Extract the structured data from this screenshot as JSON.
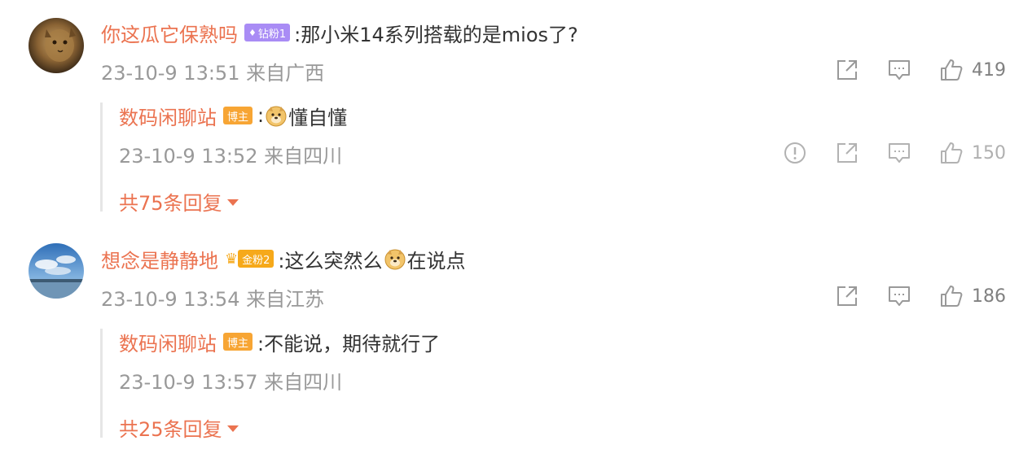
{
  "comments": [
    {
      "username": "你这瓜它保熟吗",
      "badge": "钻粉1",
      "badge_icon": "diamond-icon",
      "text": ":那小米14系列搭载的是mios了?",
      "meta": "23-10-9 13:51 来自广西",
      "likes": "419",
      "reply": {
        "username": "数码闲聊站",
        "badge": "博主",
        "text_before": ":",
        "text_after": "懂自懂",
        "meta": "23-10-9 13:52 来自四川",
        "likes": "150"
      },
      "more_replies": "共75条回复"
    },
    {
      "username": "想念是静静地",
      "badge": "金粉2",
      "badge_icon": "crown-icon",
      "text_before": ":这么突然么",
      "text_after": "在说点",
      "meta": "23-10-9 13:54 来自江苏",
      "likes": "186",
      "reply": {
        "username": "数码闲聊站",
        "badge": "博主",
        "text": ":不能说，期待就行了",
        "meta": "23-10-9 13:57 来自四川"
      },
      "more_replies": "共25条回复"
    }
  ],
  "colors": {
    "username": "#eb7350",
    "meta": "#999999",
    "badge_diamond": "#a98cf5",
    "badge_gold": "#f6a91a",
    "badge_author": "#f7a534"
  }
}
